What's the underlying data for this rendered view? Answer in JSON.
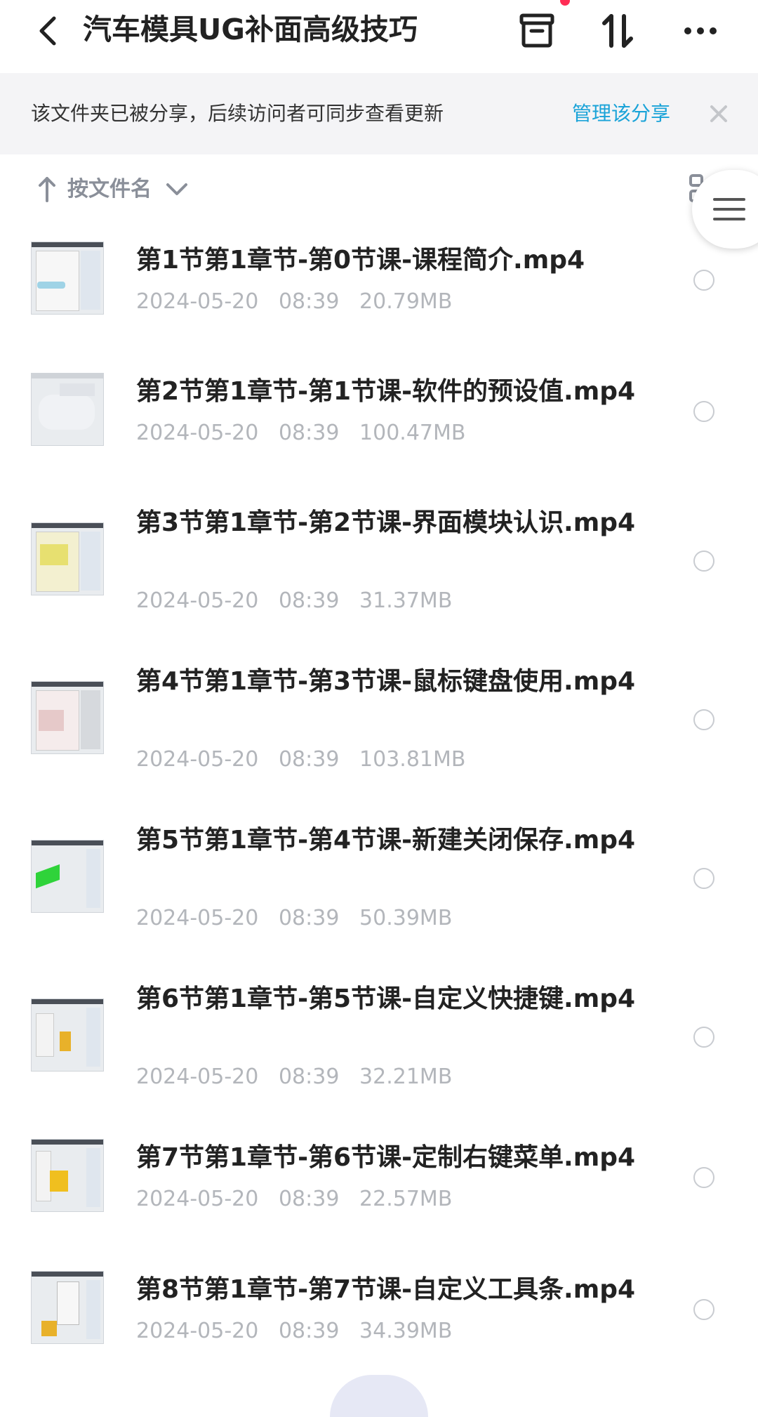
{
  "header": {
    "title": "汽车模具UG补面高级技巧",
    "icons": [
      "back-icon",
      "archive-icon",
      "transfer-icon",
      "more-icon"
    ]
  },
  "share_bar": {
    "message": "该文件夹已被分享，后续访问者可同步查看更新",
    "manage_label": "管理该分享"
  },
  "sort": {
    "label": "按文件名"
  },
  "files": [
    {
      "name": "第1节第1章节-第0节课-课程简介.mp4",
      "date": "2024-05-20",
      "time": "08:39",
      "size": "20.79MB"
    },
    {
      "name": "第2节第1章节-第1节课-软件的预设值.mp4",
      "date": "2024-05-20",
      "time": "08:39",
      "size": "100.47MB"
    },
    {
      "name": "第3节第1章节-第2节课-界面模块认识.mp4",
      "date": "2024-05-20",
      "time": "08:39",
      "size": "31.37MB"
    },
    {
      "name": "第4节第1章节-第3节课-鼠标键盘使用.mp4",
      "date": "2024-05-20",
      "time": "08:39",
      "size": "103.81MB"
    },
    {
      "name": "第5节第1章节-第4节课-新建关闭保存.mp4",
      "date": "2024-05-20",
      "time": "08:39",
      "size": "50.39MB"
    },
    {
      "name": "第6节第1章节-第5节课-自定义快捷键.mp4",
      "date": "2024-05-20",
      "time": "08:39",
      "size": "32.21MB"
    },
    {
      "name": "第7节第1章节-第6节课-定制右键菜单.mp4",
      "date": "2024-05-20",
      "time": "08:39",
      "size": "22.57MB"
    },
    {
      "name": "第8节第1章节-第7节课-自定义工具条.mp4",
      "date": "2024-05-20",
      "time": "08:39",
      "size": "34.39MB"
    }
  ],
  "colors": {
    "accent": "#1aa3d8",
    "meta_text": "#b3b6bb",
    "share_bar_bg": "#f4f4f6"
  }
}
